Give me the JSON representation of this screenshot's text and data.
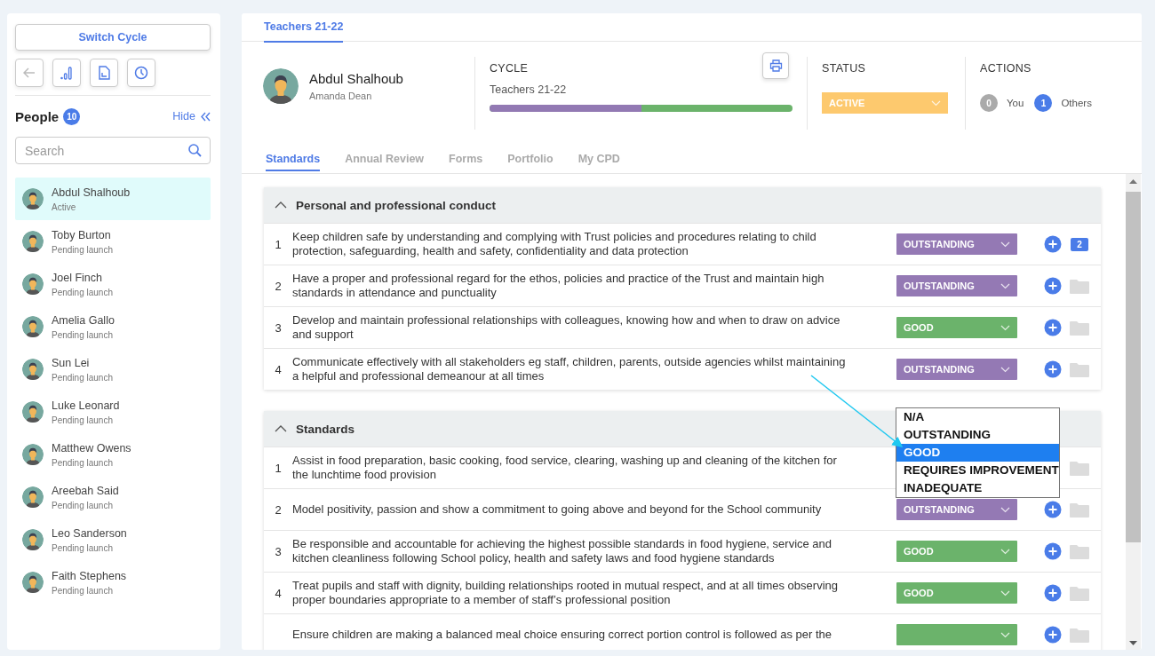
{
  "sidebar": {
    "switch_button": "Switch Cycle",
    "title": "People",
    "count": "10",
    "hide_link": "Hide",
    "search": {
      "placeholder": "Search"
    },
    "people": [
      {
        "name": "Abdul Shalhoub",
        "status": "Active",
        "selected": true
      },
      {
        "name": "Toby Burton",
        "status": "Pending launch",
        "selected": false
      },
      {
        "name": "Joel Finch",
        "status": "Pending launch",
        "selected": false
      },
      {
        "name": "Amelia Gallo",
        "status": "Pending launch",
        "selected": false
      },
      {
        "name": "Sun Lei",
        "status": "Pending launch",
        "selected": false
      },
      {
        "name": "Luke Leonard",
        "status": "Pending launch",
        "selected": false
      },
      {
        "name": "Matthew Owens",
        "status": "Pending launch",
        "selected": false
      },
      {
        "name": "Areebah Said",
        "status": "Pending launch",
        "selected": false
      },
      {
        "name": "Leo Sanderson",
        "status": "Pending launch",
        "selected": false
      },
      {
        "name": "Faith Stephens",
        "status": "Pending launch",
        "selected": false
      }
    ]
  },
  "main": {
    "cycle_tabs": [
      {
        "label": "Teachers 21-22",
        "selected": true
      }
    ],
    "profile": {
      "name": "Abdul Shalhoub",
      "subtitle": "Amanda Dean"
    },
    "cycle": {
      "heading": "CYCLE",
      "name": "Teachers 21-22",
      "level": 0.5
    },
    "status": {
      "heading": "STATUS",
      "value": "ACTIVE"
    },
    "actions": {
      "heading": "ACTIONS",
      "items": [
        {
          "count": "0",
          "label": "You",
          "highlighted": false
        },
        {
          "count": "1",
          "label": "Others",
          "highlighted": true
        }
      ]
    },
    "tabs": [
      {
        "label": "Standards",
        "selected": true
      },
      {
        "label": "Annual Review",
        "selected": false
      },
      {
        "label": "Forms",
        "selected": false
      },
      {
        "label": "Portfolio",
        "selected": false
      },
      {
        "label": "My CPD",
        "selected": false
      }
    ],
    "sections": [
      {
        "title": "Personal and professional conduct",
        "expanded": true,
        "rows": [
          {
            "number": "1",
            "text": "Keep children safe by understanding and complying with Trust policies and procedures relating to child protection, safeguarding, health and safety, confidentiality and data protection",
            "rating": {
              "label": "OUTSTANDING",
              "kind": "outstanding"
            },
            "attachments": "2"
          },
          {
            "number": "2",
            "text": "Have a proper and professional regard for the ethos, policies and practice of the Trust and maintain high standards in attendance and punctuality",
            "rating": {
              "label": "OUTSTANDING",
              "kind": "outstanding"
            }
          },
          {
            "number": "3",
            "text": "Develop and maintain professional relationships with colleagues, knowing how and when to draw on advice and support",
            "rating": {
              "label": "GOOD",
              "kind": "good"
            }
          },
          {
            "number": "4",
            "text": "Communicate effectively with all stakeholders eg staff, children, parents, outside agencies whilst maintaining a helpful and professional demeanour at all times",
            "rating": {
              "label": "OUTSTANDING",
              "kind": "outstanding"
            }
          }
        ]
      },
      {
        "title": "Standards",
        "expanded": true,
        "rows": [
          {
            "number": "1",
            "text": "Assist in food preparation, basic cooking, food service, clearing, washing up and cleaning of the kitchen for the lunchtime food provision",
            "menu": [
              {
                "label": "N/A",
                "selected": false
              },
              {
                "label": "OUTSTANDING",
                "selected": false
              },
              {
                "label": "GOOD",
                "selected": true
              },
              {
                "label": "REQUIRES IMPROVEMENT",
                "selected": false
              },
              {
                "label": "INADEQUATE",
                "selected": false
              }
            ]
          },
          {
            "number": "2",
            "text": "Model positivity, passion and show a commitment to going above and beyond for the School community",
            "rating": {
              "label": "OUTSTANDING",
              "kind": "outstanding"
            }
          },
          {
            "number": "3",
            "text": "Be responsible and accountable for achieving the highest possible standards in food hygiene, service and kitchen cleanliness following School policy, health and safety laws and food hygiene standards",
            "rating": {
              "label": "GOOD",
              "kind": "good"
            }
          },
          {
            "number": "4",
            "text": "Treat pupils and staff with dignity, building relationships rooted in mutual respect, and at all times observing proper boundaries appropriate to a member of staff’s professional position",
            "rating": {
              "label": "GOOD",
              "kind": "good"
            }
          },
          {
            "text": "Ensure children are making a balanced meal choice ensuring correct portion control is followed as per the",
            "rating": {
              "kind": "good"
            }
          }
        ]
      }
    ]
  }
}
